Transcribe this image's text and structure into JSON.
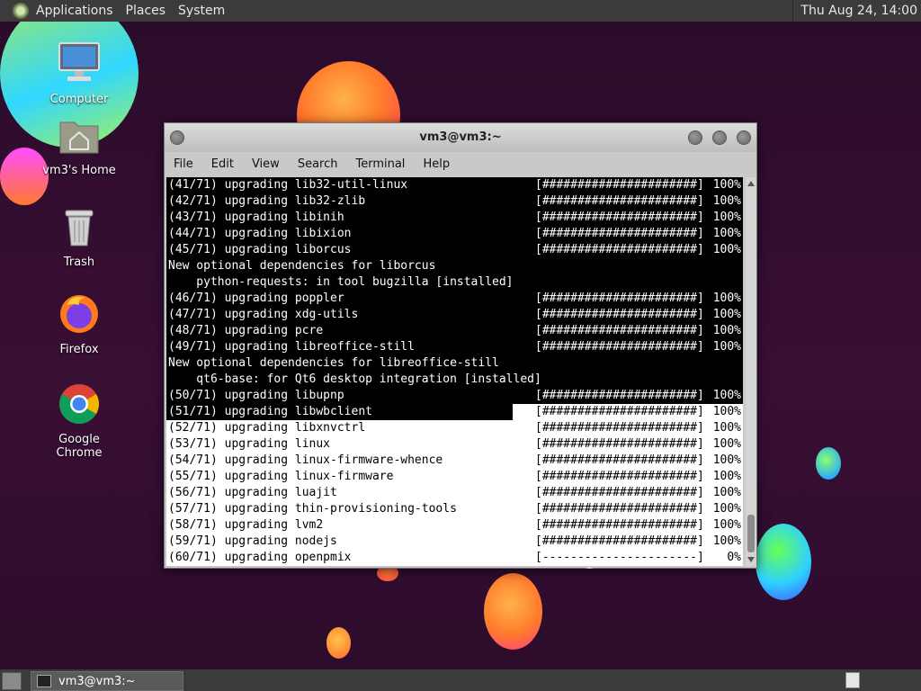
{
  "top_panel": {
    "menus": [
      "Applications",
      "Places",
      "System"
    ],
    "clock": "Thu Aug 24, 14:00"
  },
  "desktop": {
    "icons": [
      {
        "label": "Computer",
        "icon": "computer-icon"
      },
      {
        "label": "vm3's Home",
        "icon": "home-folder-icon"
      },
      {
        "label": "Trash",
        "icon": "trash-icon"
      },
      {
        "label": "Firefox",
        "icon": "firefox-icon"
      },
      {
        "label": "Google Chrome",
        "icon": "chrome-icon"
      }
    ]
  },
  "terminal": {
    "title": "vm3@vm3:~",
    "menu": [
      "File",
      "Edit",
      "View",
      "Search",
      "Terminal",
      "Help"
    ],
    "lines": [
      {
        "text": "(41/71) upgrading lib32-util-linux",
        "bar": "[######################]",
        "pct": "100%"
      },
      {
        "text": "(42/71) upgrading lib32-zlib",
        "bar": "[######################]",
        "pct": "100%"
      },
      {
        "text": "(43/71) upgrading libinih",
        "bar": "[######################]",
        "pct": "100%"
      },
      {
        "text": "(44/71) upgrading libixion",
        "bar": "[######################]",
        "pct": "100%"
      },
      {
        "text": "(45/71) upgrading liborcus",
        "bar": "[######################]",
        "pct": "100%"
      },
      {
        "text": "New optional dependencies for liborcus",
        "bar": "",
        "pct": ""
      },
      {
        "text": "    python-requests: in tool bugzilla [installed]",
        "bar": "",
        "pct": ""
      },
      {
        "text": "(46/71) upgrading poppler",
        "bar": "[######################]",
        "pct": "100%"
      },
      {
        "text": "(47/71) upgrading xdg-utils",
        "bar": "[######################]",
        "pct": "100%"
      },
      {
        "text": "(48/71) upgrading pcre",
        "bar": "[######################]",
        "pct": "100%"
      },
      {
        "text": "(49/71) upgrading libreoffice-still",
        "bar": "[######################]",
        "pct": "100%"
      },
      {
        "text": "New optional dependencies for libreoffice-still",
        "bar": "",
        "pct": ""
      },
      {
        "text": "    qt6-base: for Qt6 desktop integration [installed]",
        "bar": "",
        "pct": ""
      },
      {
        "text": "(50/71) upgrading libupnp",
        "bar": "[######################]",
        "pct": "100%"
      },
      {
        "text": "(51/71) upgrading libwbclient",
        "bar": "[######################]",
        "pct": "100%"
      },
      {
        "text": "(52/71) upgrading libxnvctrl",
        "bar": "[######################]",
        "pct": "100%"
      },
      {
        "text": "(53/71) upgrading linux",
        "bar": "[######################]",
        "pct": "100%"
      },
      {
        "text": "(54/71) upgrading linux-firmware-whence",
        "bar": "[######################]",
        "pct": "100%"
      },
      {
        "text": "(55/71) upgrading linux-firmware",
        "bar": "[######################]",
        "pct": "100%"
      },
      {
        "text": "(56/71) upgrading luajit",
        "bar": "[######################]",
        "pct": "100%"
      },
      {
        "text": "(57/71) upgrading thin-provisioning-tools",
        "bar": "[######################]",
        "pct": "100%"
      },
      {
        "text": "(58/71) upgrading lvm2",
        "bar": "[######################]",
        "pct": "100%"
      },
      {
        "text": "(59/71) upgrading nodejs",
        "bar": "[######################]",
        "pct": "100%"
      },
      {
        "text": "(60/71) upgrading openpmix",
        "bar": "[----------------------]",
        "pct": "0%"
      }
    ]
  },
  "taskbar": {
    "task_label": "vm3@vm3:~"
  }
}
